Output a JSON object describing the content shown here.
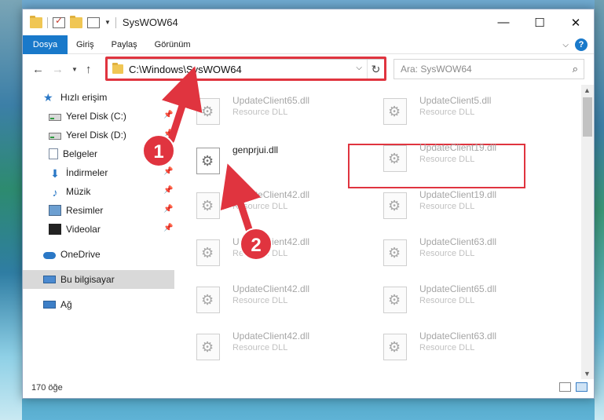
{
  "window": {
    "title": "SysWOW64",
    "minimize": "—",
    "maximize": "☐",
    "close": "✕"
  },
  "ribbon": {
    "tabs": [
      "Dosya",
      "Giriş",
      "Paylaş",
      "Görünüm"
    ],
    "help": "?"
  },
  "address": {
    "path": "C:\\Windows\\SysWOW64",
    "search_placeholder": "Ara: SysWOW64"
  },
  "nav": {
    "items": [
      {
        "label": "Hızlı erişim",
        "icon": "star-icon"
      },
      {
        "label": "Yerel Disk (C:)",
        "icon": "drive-icon"
      },
      {
        "label": "Yerel Disk (D:)",
        "icon": "drive-icon"
      },
      {
        "label": "Belgeler",
        "icon": "documents-icon"
      },
      {
        "label": "İndirmeler",
        "icon": "download-icon"
      },
      {
        "label": "Müzik",
        "icon": "music-icon"
      },
      {
        "label": "Resimler",
        "icon": "pictures-icon"
      },
      {
        "label": "Videolar",
        "icon": "videos-icon"
      },
      {
        "label": "OneDrive",
        "icon": "cloud-icon"
      },
      {
        "label": "Bu bilgisayar",
        "icon": "computer-icon"
      },
      {
        "label": "Ağ",
        "icon": "network-icon"
      }
    ]
  },
  "files": {
    "main": {
      "name": "genprjui.dll"
    },
    "left": [
      {
        "name": "UpdateClient65.dll",
        "type": "Resource DLL"
      },
      {
        "name": "UpdateClient42.dll",
        "type": "Resource DLL"
      },
      {
        "name": "UpdateClient42.dll",
        "type": "Resource DLL"
      },
      {
        "name": "UpdateClient42.dll",
        "type": "Resource DLL"
      },
      {
        "name": "UpdateClient42.dll",
        "type": "Resource DLL"
      }
    ],
    "right": [
      {
        "name": "UpdateClient5.dll",
        "type": "Resource DLL"
      },
      {
        "name": "UpdateClient19.dll",
        "type": "Resource DLL"
      },
      {
        "name": "UpdateClient19.dll",
        "type": "Resource DLL"
      },
      {
        "name": "UpdateClient63.dll",
        "type": "Resource DLL"
      },
      {
        "name": "UpdateClient65.dll",
        "type": "Resource DLL"
      },
      {
        "name": "UpdateClient63.dll",
        "type": "Resource DLL"
      }
    ]
  },
  "status": {
    "count": "170 öğe"
  },
  "annotations": {
    "badge1": "1",
    "badge2": "2",
    "color": "#e0343f"
  }
}
